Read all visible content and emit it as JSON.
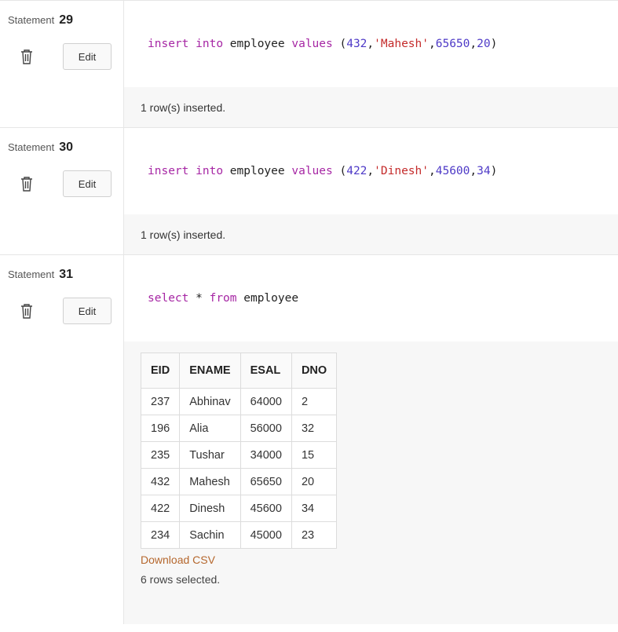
{
  "statements": [
    {
      "label": "Statement",
      "number": "29",
      "edit_label": "Edit",
      "code_tokens": [
        {
          "t": "insert",
          "c": "kw"
        },
        {
          "t": " ",
          "c": ""
        },
        {
          "t": "into",
          "c": "kw"
        },
        {
          "t": " employee ",
          "c": ""
        },
        {
          "t": "values",
          "c": "kw"
        },
        {
          "t": " (",
          "c": ""
        },
        {
          "t": "432",
          "c": "numv"
        },
        {
          "t": ",",
          "c": ""
        },
        {
          "t": "'Mahesh'",
          "c": "str"
        },
        {
          "t": ",",
          "c": ""
        },
        {
          "t": "65650",
          "c": "numv"
        },
        {
          "t": ",",
          "c": ""
        },
        {
          "t": "20",
          "c": "numv"
        },
        {
          "t": ")",
          "c": ""
        }
      ],
      "result_text": "1 row(s) inserted."
    },
    {
      "label": "Statement",
      "number": "30",
      "edit_label": "Edit",
      "code_tokens": [
        {
          "t": "insert",
          "c": "kw"
        },
        {
          "t": " ",
          "c": ""
        },
        {
          "t": "into",
          "c": "kw"
        },
        {
          "t": " employee ",
          "c": ""
        },
        {
          "t": "values",
          "c": "kw"
        },
        {
          "t": " (",
          "c": ""
        },
        {
          "t": "422",
          "c": "numv"
        },
        {
          "t": ",",
          "c": ""
        },
        {
          "t": "'Dinesh'",
          "c": "str"
        },
        {
          "t": ",",
          "c": ""
        },
        {
          "t": "45600",
          "c": "numv"
        },
        {
          "t": ",",
          "c": ""
        },
        {
          "t": "34",
          "c": "numv"
        },
        {
          "t": ")",
          "c": ""
        }
      ],
      "result_text": "1 row(s) inserted."
    },
    {
      "label": "Statement",
      "number": "31",
      "edit_label": "Edit",
      "code_tokens": [
        {
          "t": "select",
          "c": "kw"
        },
        {
          "t": " * ",
          "c": ""
        },
        {
          "t": "from",
          "c": "kw"
        },
        {
          "t": " employee",
          "c": ""
        }
      ],
      "table": {
        "columns": [
          "EID",
          "ENAME",
          "ESAL",
          "DNO"
        ],
        "rows": [
          [
            "237",
            "Abhinav",
            "64000",
            "2"
          ],
          [
            "196",
            "Alia",
            "56000",
            "32"
          ],
          [
            "235",
            "Tushar",
            "34000",
            "15"
          ],
          [
            "432",
            "Mahesh",
            "65650",
            "20"
          ],
          [
            "422",
            "Dinesh",
            "45600",
            "34"
          ],
          [
            "234",
            "Sachin",
            "45000",
            "23"
          ]
        ]
      },
      "download_label": "Download CSV",
      "rows_selected": "6 rows selected."
    }
  ],
  "icons": {
    "delete": "trash-icon"
  },
  "colors": {
    "keyword": "#a626a4",
    "number": "#4e3ac7",
    "string": "#c42a2a",
    "link": "#b5672d"
  }
}
